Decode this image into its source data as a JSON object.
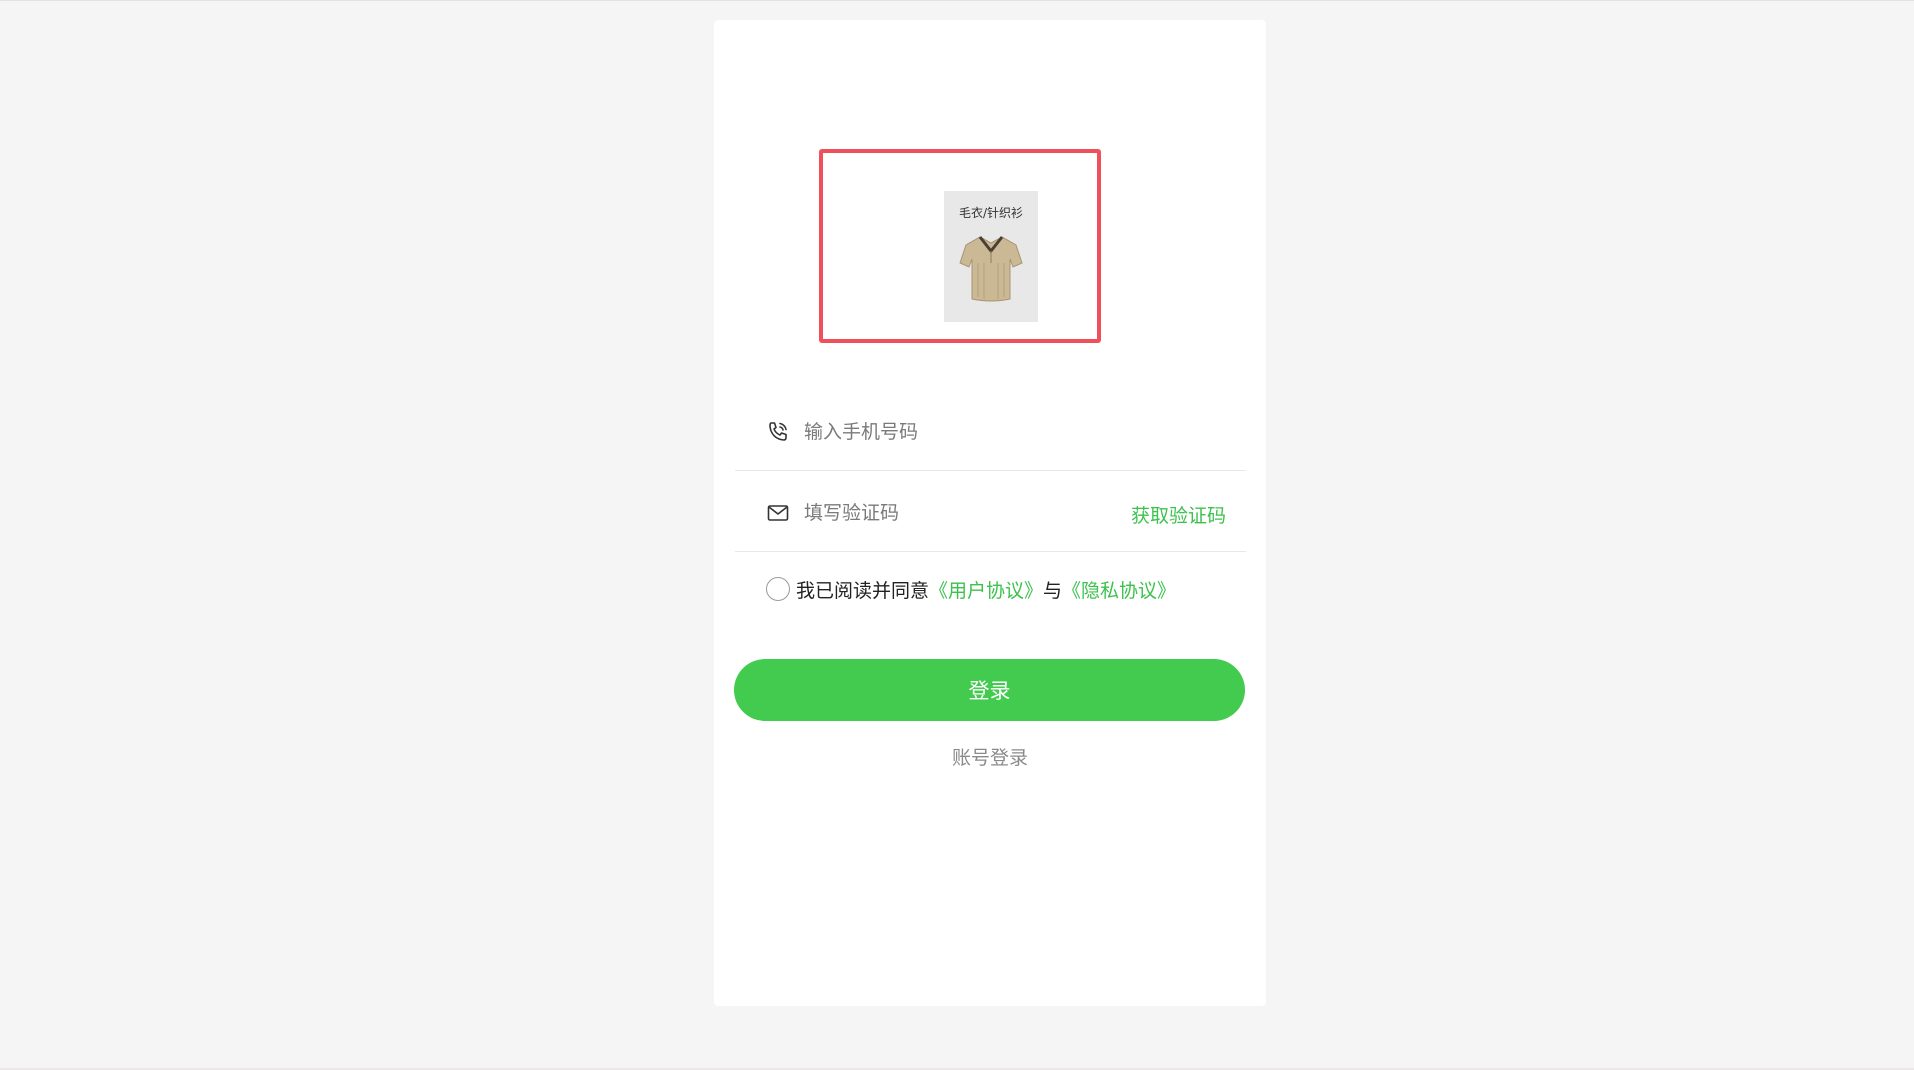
{
  "logo": {
    "caption": "毛衣/针织衫",
    "image_icon": "knit-polo-shirt-icon"
  },
  "phone_field": {
    "icon": "phone-icon",
    "placeholder": "输入手机号码"
  },
  "code_field": {
    "icon": "envelope-icon",
    "placeholder": "填写验证码",
    "get_code_label": "获取验证码"
  },
  "agreement": {
    "prefix": "我已阅读并同意",
    "user_agreement": "《用户协议》",
    "conjunction": "与",
    "privacy_agreement": "《隐私协议》",
    "checked": false
  },
  "login_button_label": "登录",
  "account_login_label": "账号登录",
  "colors": {
    "accent_green": "#43cb50",
    "link_green": "#3cc24c",
    "highlight_frame": "#f0505a",
    "page_background": "#f5f5f5"
  }
}
